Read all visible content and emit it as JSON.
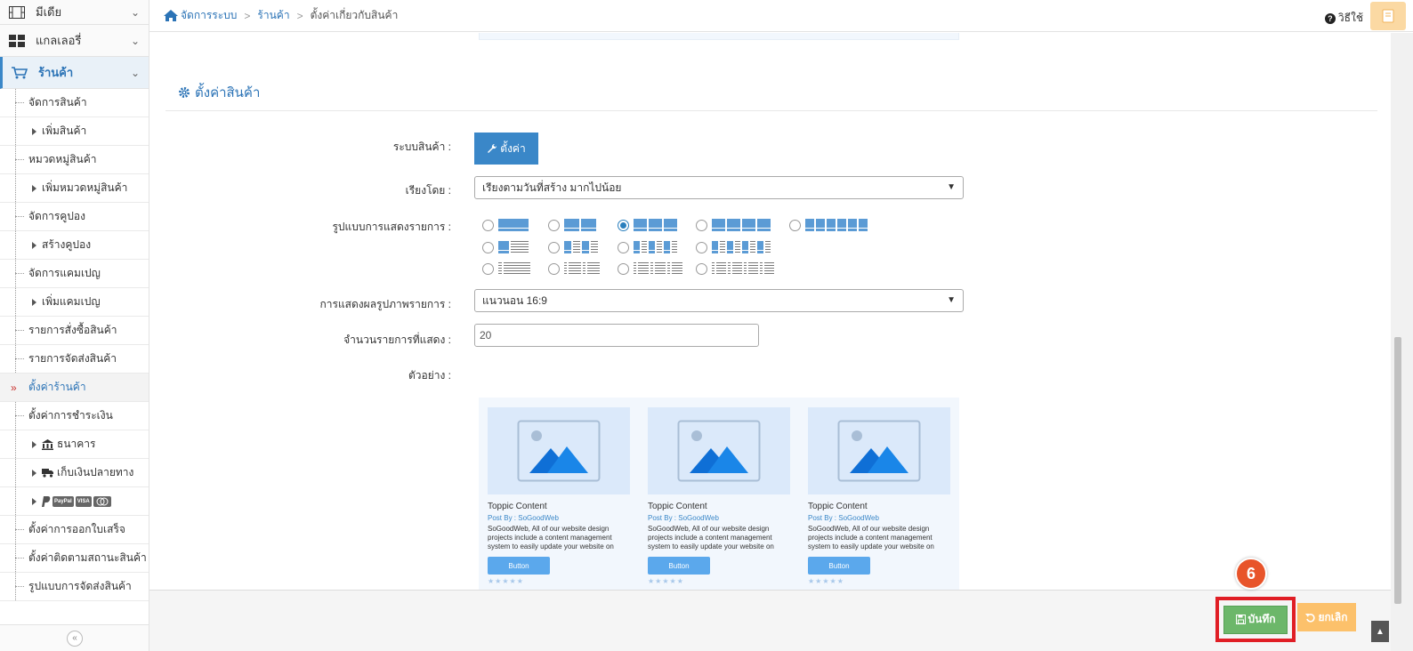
{
  "sidebar": {
    "top_items": [
      {
        "label": "มีเดีย",
        "icon": "film-icon"
      },
      {
        "label": "แกลเลอรี่",
        "icon": "grid-icon"
      },
      {
        "label": "ร้านค้า",
        "icon": "cart-icon"
      }
    ],
    "sub_items": [
      {
        "label": "จัดการสินค้า"
      },
      {
        "label": "เพิ่มสินค้า"
      },
      {
        "label": "หมวดหมู่สินค้า"
      },
      {
        "label": "เพิ่มหมวดหมู่สินค้า"
      },
      {
        "label": "จัดการคูปอง"
      },
      {
        "label": "สร้างคูปอง"
      },
      {
        "label": "จัดการแคมเปญ"
      },
      {
        "label": "เพิ่มแคมเปญ"
      },
      {
        "label": "รายการสั่งซื้อสินค้า"
      },
      {
        "label": "รายการจัดส่งสินค้า"
      },
      {
        "label": "ตั้งค่าร้านค้า"
      },
      {
        "label": "ตั้งค่าการชำระเงิน"
      },
      {
        "label": "ธนาคาร"
      },
      {
        "label": "เก็บเงินปลายทาง"
      },
      {
        "label": ""
      },
      {
        "label": "ตั้งค่าการออกใบเสร็จ"
      },
      {
        "label": "ตั้งค่าติดตามสถานะสินค้า"
      },
      {
        "label": "รูปแบบการจัดส่งสินค้า"
      }
    ],
    "pay_labels": {
      "paypal": "PayPal",
      "visa": "VISA"
    },
    "collapse_icon": "«"
  },
  "breadcrumb": {
    "home": "จัดการระบบ",
    "shop": "ร้านค้า",
    "current": "ตั้งค่าเกี่ยวกับสินค้า",
    "sep": ">"
  },
  "help_label": "วิธีใช้",
  "section": {
    "title": "ตั้งค่าสินค้า"
  },
  "form": {
    "product_system_label": "ระบบสินค้า :",
    "settings_button": "ตั้งค่า",
    "sort_label": "เรียงโดย :",
    "sort_value": "เรียงตามวันที่สร้าง มากไปน้อย",
    "layout_label": "รูปแบบการแสดงรายการ :",
    "image_display_label": "การแสดงผลรูปภาพรายการ :",
    "image_display_value": "แนวนอน 16:9",
    "count_label": "จำนวนรายการที่แสดง :",
    "count_value": "20",
    "example_label": "ตัวอย่าง :"
  },
  "layout_options": {
    "selected": "row1-col3"
  },
  "preview": {
    "cards": [
      {
        "title": "Toppic Content",
        "by": "Post By : SoGoodWeb",
        "desc": "SoGoodWeb, All of our website design projects include a content management system to easily update your website on",
        "button": "Button",
        "stars": "★★★★★"
      },
      {
        "title": "Toppic Content",
        "by": "Post By : SoGoodWeb",
        "desc": "SoGoodWeb, All of our website design projects include a content management system to easily update your website on",
        "button": "Button",
        "stars": "★★★★★"
      },
      {
        "title": "Toppic Content",
        "by": "Post By : SoGoodWeb",
        "desc": "SoGoodWeb, All of our website design projects include a content management system to easily update your website on",
        "button": "Button",
        "stars": "★★★★★"
      }
    ]
  },
  "footer": {
    "save": "บันทึก",
    "cancel": "ยกเลิก",
    "step_badge": "6"
  },
  "colors": {
    "primary": "#3a87c8",
    "save": "#6cb76a",
    "cancel": "#fcc16b",
    "highlight": "#e01e25",
    "badge": "#e8542a"
  }
}
